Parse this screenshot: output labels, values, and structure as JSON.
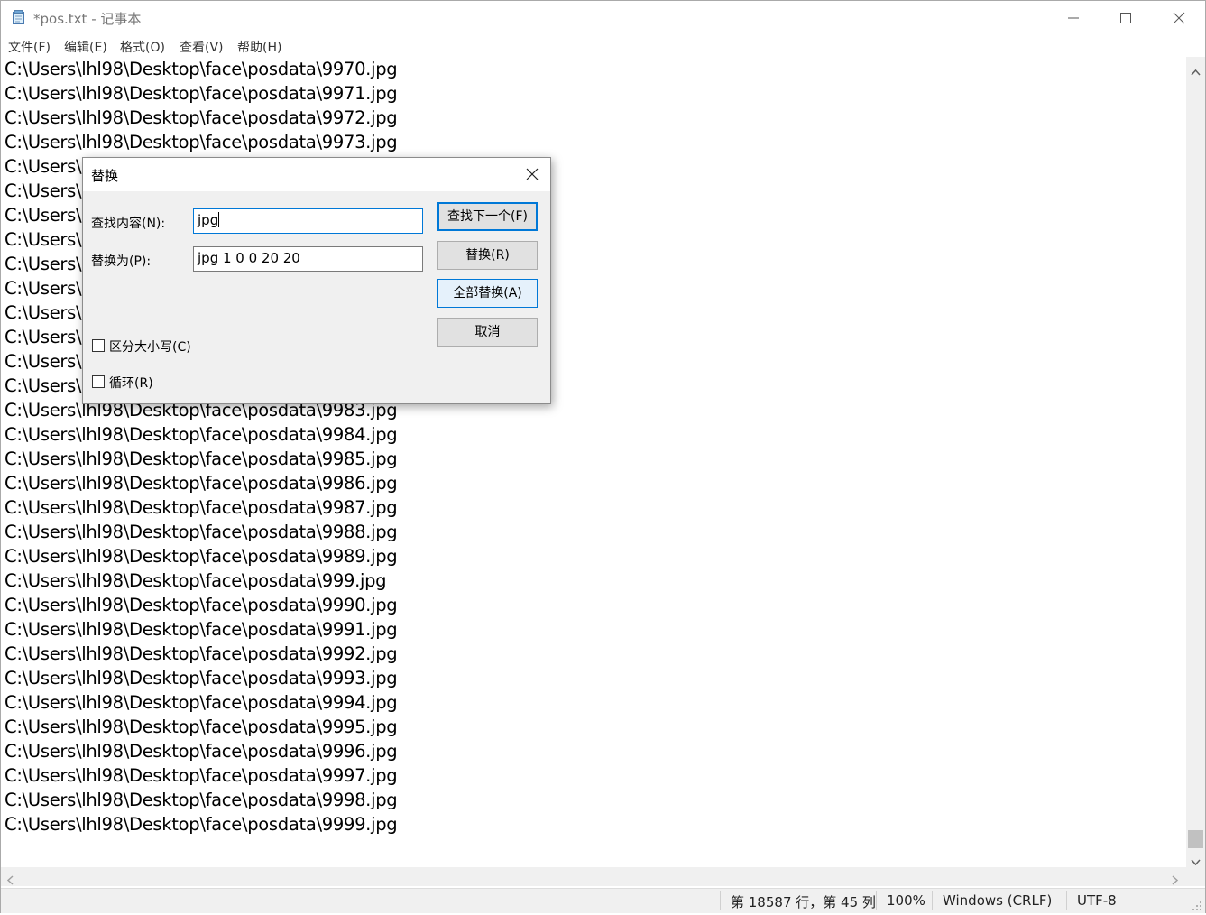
{
  "window": {
    "title": "*pos.txt - 记事本",
    "app_icon": "notepad-icon"
  },
  "menu": {
    "file": "文件(F)",
    "edit": "编辑(E)",
    "format": "格式(O)",
    "view": "查看(V)",
    "help": "帮助(H)"
  },
  "editor": {
    "lines": [
      "C:\\Users\\lhl98\\Desktop\\face\\posdata\\9970.jpg",
      "C:\\Users\\lhl98\\Desktop\\face\\posdata\\9971.jpg",
      "C:\\Users\\lhl98\\Desktop\\face\\posdata\\9972.jpg",
      "C:\\Users\\lhl98\\Desktop\\face\\posdata\\9973.jpg",
      "C:\\Users\\",
      "C:\\Users\\",
      "C:\\Users\\",
      "C:\\Users\\",
      "C:\\Users\\",
      "C:\\Users\\",
      "C:\\Users\\",
      "C:\\Users\\",
      "C:\\Users\\",
      "C:\\Users\\",
      "C:\\Users\\lhl98\\Desktop\\face\\posdata\\9983.jpg",
      "C:\\Users\\lhl98\\Desktop\\face\\posdata\\9984.jpg",
      "C:\\Users\\lhl98\\Desktop\\face\\posdata\\9985.jpg",
      "C:\\Users\\lhl98\\Desktop\\face\\posdata\\9986.jpg",
      "C:\\Users\\lhl98\\Desktop\\face\\posdata\\9987.jpg",
      "C:\\Users\\lhl98\\Desktop\\face\\posdata\\9988.jpg",
      "C:\\Users\\lhl98\\Desktop\\face\\posdata\\9989.jpg",
      "C:\\Users\\lhl98\\Desktop\\face\\posdata\\999.jpg",
      "C:\\Users\\lhl98\\Desktop\\face\\posdata\\9990.jpg",
      "C:\\Users\\lhl98\\Desktop\\face\\posdata\\9991.jpg",
      "C:\\Users\\lhl98\\Desktop\\face\\posdata\\9992.jpg",
      "C:\\Users\\lhl98\\Desktop\\face\\posdata\\9993.jpg",
      "C:\\Users\\lhl98\\Desktop\\face\\posdata\\9994.jpg",
      "C:\\Users\\lhl98\\Desktop\\face\\posdata\\9995.jpg",
      "C:\\Users\\lhl98\\Desktop\\face\\posdata\\9996.jpg",
      "C:\\Users\\lhl98\\Desktop\\face\\posdata\\9997.jpg",
      "C:\\Users\\lhl98\\Desktop\\face\\posdata\\9998.jpg",
      "C:\\Users\\lhl98\\Desktop\\face\\posdata\\9999.jpg"
    ]
  },
  "status": {
    "position": "第 18587 行，第 45 列",
    "zoom": "100%",
    "line_ending": "Windows (CRLF)",
    "encoding": "UTF-8"
  },
  "dialog": {
    "title": "替换",
    "find_label": "查找内容(N):",
    "find_value": "jpg",
    "replace_label": "替换为(P):",
    "replace_value": "jpg 1 0 0 20 20",
    "find_next_button": "查找下一个(F)",
    "replace_button": "替换(R)",
    "replace_all_button": "全部替换(A)",
    "cancel_button": "取消",
    "match_case_label": "区分大小写(C)",
    "match_case_checked": false,
    "wrap_label": "循环(R)",
    "wrap_checked": false
  },
  "colors": {
    "accent": "#0078d7",
    "dialog_bg": "#f0f0f0",
    "button_bg": "#e1e1e1"
  }
}
